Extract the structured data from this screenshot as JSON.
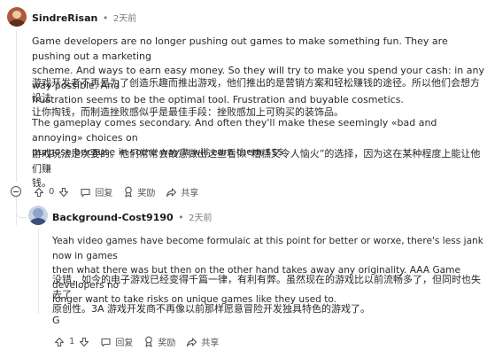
{
  "comment": {
    "username": "SindreRisan",
    "separator": "•",
    "time": "2天前",
    "paragraphs": [
      [
        "Game developers are no longer pushing out games to make something fun. They are pushing out a marketing",
        "scheme. And ways to earn easy money. So they will try to make you spend your cash: in any way possible. And",
        "frustration seems to be the optimal tool. Frustration and buyable cosmetics."
      ],
      [
        "游戏开发者不再是为了创造乐趣而推出游戏，他们推出的是营销方案和轻松赚钱的途径。所以他们会想方设法",
        "让你掏钱，而制造挫败感似乎是最佳手段：挫败感加上可购买的装饰品。"
      ],
      [
        "The gameplay comes secondary. And often they'll make these seemingly «bad and annoying» choices on",
        "purpose because in some way it will earn them $$$"
      ],
      [
        "游戏玩法是次要的。他们常常会故意做出这些看似“糟糕又令人恼火”的选择，因为这在某种程度上能让他们赚",
        "钱。"
      ]
    ],
    "vote_count": "0",
    "reply_label": "回复",
    "award_label": "奖励",
    "share_label": "共享"
  },
  "reply": {
    "username": "Background-Cost9190",
    "separator": "•",
    "time": "2天前",
    "paragraphs": [
      [
        "Yeah video games have become formulaic at this point for better or worxe, there's less jank now in games",
        "then what there was but then on the other hand takes away any originality. AAA Game developers no",
        "longer want to take risks on unique games like they used to."
      ],
      [
        "没错，如今的电子游戏已经变得千篇一律，有利有弊。虽然现在的游戏比以前流畅多了，但同时也失去了",
        "原创性。3A 游戏开发商不再像以前那样愿意冒险开发独具特色的游戏了。"
      ],
      [
        "G"
      ]
    ],
    "vote_count": "1",
    "reply_label": "回复",
    "award_label": "奖励",
    "share_label": "共享"
  },
  "icons": {
    "upvote": "upvote-arrow-icon",
    "downvote": "downvote-arrow-icon",
    "reply": "speech-bubble-icon",
    "award": "award-ribbon-icon",
    "share": "share-arrow-icon",
    "collapse": "collapse-minus-icon"
  }
}
